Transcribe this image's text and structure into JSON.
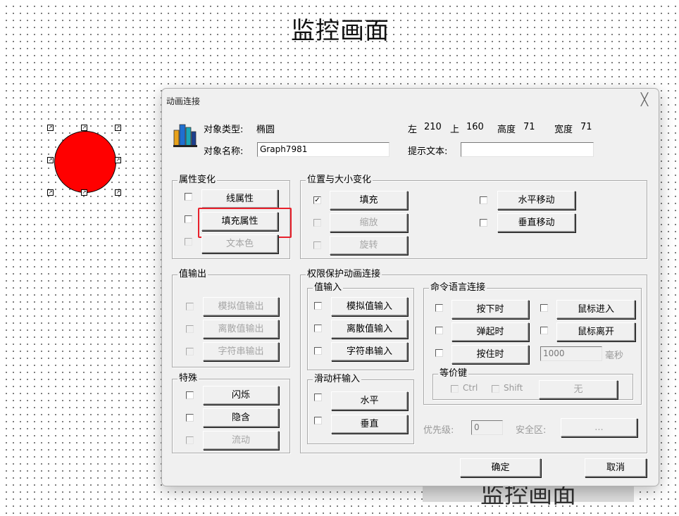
{
  "canvas": {
    "title": "监控画面",
    "bottom_text": "监控画面"
  },
  "dialog": {
    "title": "动画连接",
    "close_glyph": "╳",
    "object_type_label": "对象类型:",
    "object_type_value": "椭圆",
    "pos_left_label": "左",
    "pos_left_value": "210",
    "pos_top_label": "上",
    "pos_top_value": "160",
    "height_label": "高度",
    "height_value": "71",
    "width_label": "宽度",
    "width_value": "71",
    "object_name_label": "对象名称:",
    "object_name_value": "Graph7981",
    "hint_text_label": "提示文本:",
    "hint_text_value": "",
    "groups": {
      "attribute": "属性变化",
      "position_size": "位置与大小变化",
      "value_output": "值输出",
      "special": "特殊",
      "permission": "权限保护动画连接",
      "value_input": "值输入",
      "command": "命令语言连接",
      "slider_input": "滑动杆输入",
      "hotkey": "等价键"
    },
    "buttons": {
      "line_attr": "线属性",
      "fill_attr": "填充属性",
      "text_color": "文本色",
      "fill": "填充",
      "scale": "缩放",
      "rotate": "旋转",
      "h_move": "水平移动",
      "v_move": "垂直移动",
      "analog_out": "模拟值输出",
      "discrete_out": "离散值输出",
      "string_out": "字符串输出",
      "blink": "闪烁",
      "hide": "隐含",
      "flow": "流动",
      "analog_in": "模拟值输入",
      "discrete_in": "离散值输入",
      "string_in": "字符串输入",
      "horizontal": "水平",
      "vertical": "垂直",
      "press_down": "按下时",
      "release": "弹起时",
      "hold": "按住时",
      "mouse_enter": "鼠标进入",
      "mouse_leave": "鼠标离开",
      "none_key": "无",
      "ellipsis": "...",
      "ok": "确定",
      "cancel": "取消"
    },
    "hold_ms_value": "1000",
    "ms_unit": "毫秒",
    "ctrl_label": "Ctrl",
    "shift_label": "Shift",
    "priority_label": "优先级:",
    "priority_value": "0",
    "security_label": "安全区:",
    "fill_checked": "☑",
    "check_mark": "✓",
    "handle_glyph": "↗"
  },
  "colors": {
    "ellipse_fill": "#ff0000",
    "highlight": "#e8202b",
    "dialog_bg": "#f0f0f0"
  }
}
